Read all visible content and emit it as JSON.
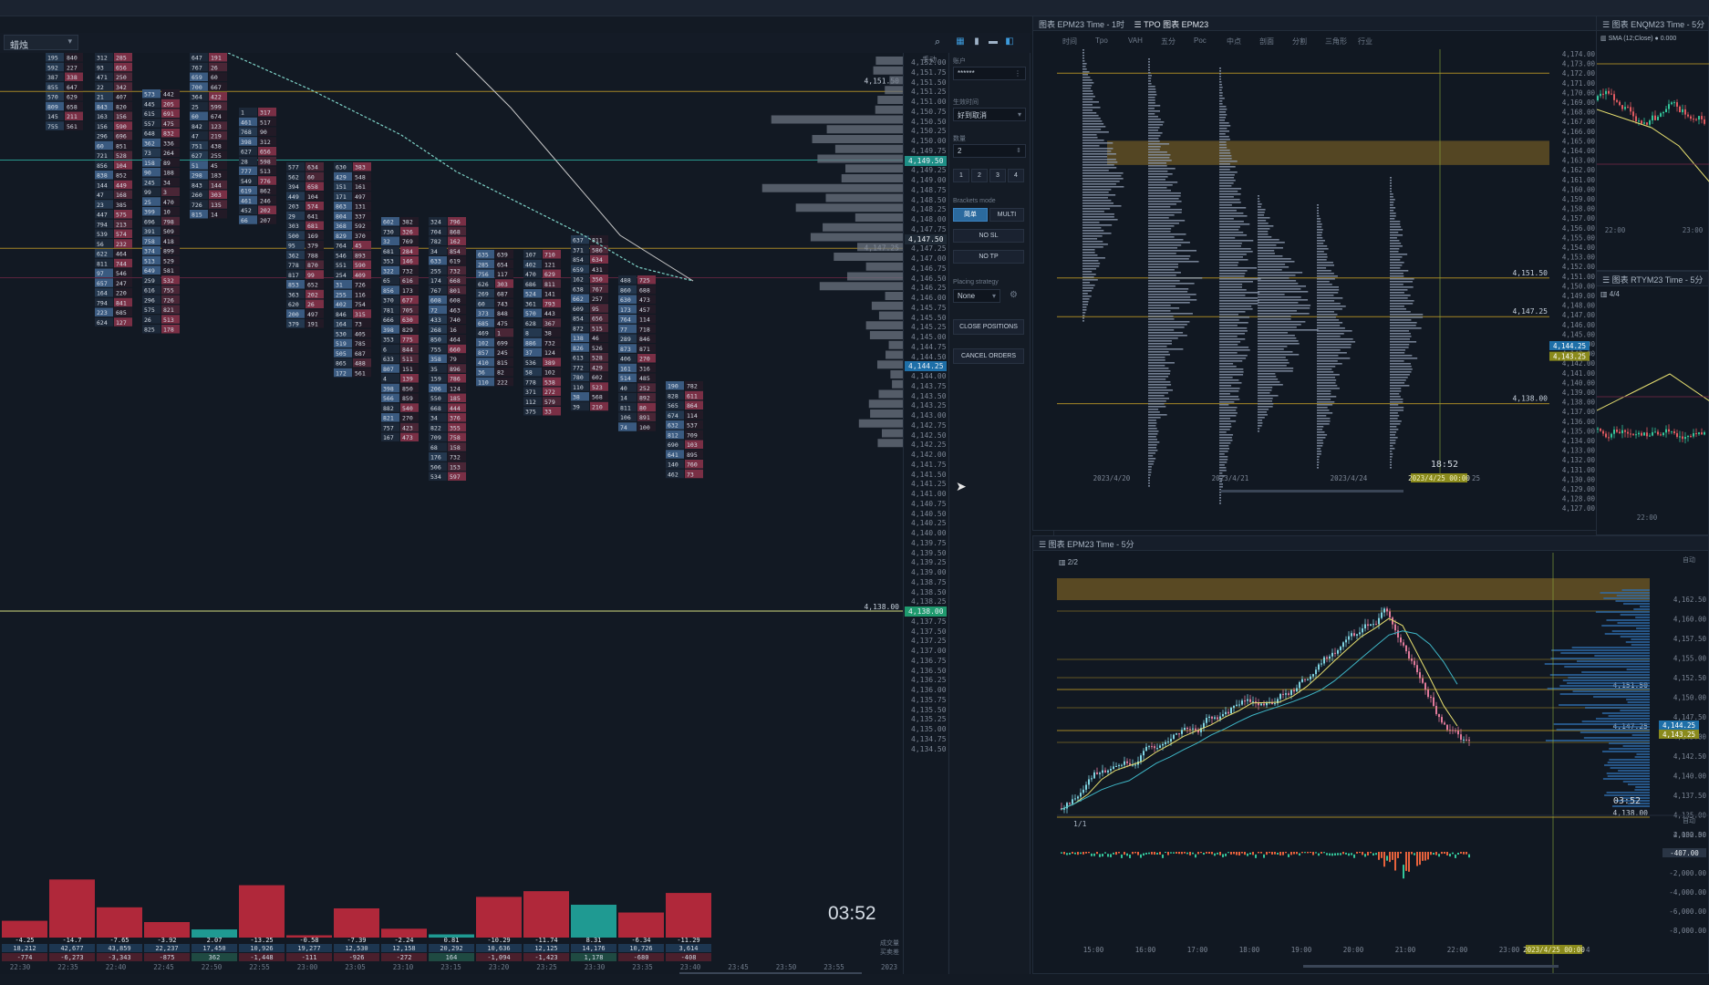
{
  "topbar": {},
  "main": {
    "instrument": "蜡烛",
    "price_ticks": [
      "4,152.00",
      "4,151.75",
      "4,151.50",
      "4,151.25",
      "4,151.00",
      "4,150.75",
      "4,150.50",
      "4,150.25",
      "4,150.00",
      "4,149.75",
      "4,149.50",
      "4,149.25",
      "4,149.00",
      "4,148.75",
      "4,148.50",
      "4,148.25",
      "4,148.00",
      "4,147.75",
      "4,147.50",
      "4,147.25",
      "4,147.00",
      "4,146.75",
      "4,146.50",
      "4,146.25",
      "4,146.00",
      "4,145.75",
      "4,145.50",
      "4,145.25",
      "4,145.00",
      "4,144.75",
      "4,144.50",
      "4,144.25",
      "4,144.00",
      "4,143.75",
      "4,143.50",
      "4,143.25",
      "4,143.00",
      "4,142.75",
      "4,142.50",
      "4,142.25",
      "4,142.00",
      "4,141.75",
      "4,141.50",
      "4,141.25",
      "4,141.00",
      "4,140.75",
      "4,140.50",
      "4,140.25",
      "4,140.00",
      "4,139.75",
      "4,139.50",
      "4,139.25",
      "4,139.00",
      "4,138.75",
      "4,138.50",
      "4,138.25",
      "4,138.00",
      "4,137.75",
      "4,137.50",
      "4,137.25",
      "4,137.00",
      "4,136.75",
      "4,136.50",
      "4,136.25",
      "4,136.00",
      "4,135.75",
      "4,135.50",
      "4,135.25",
      "4,135.00",
      "4,134.75",
      "4,134.50"
    ],
    "price_hl": [
      {
        "label": "4,149.50",
        "color": "#1e8f86"
      },
      {
        "label": "4,147.50",
        "color": "#1f2a36"
      },
      {
        "label": "4,144.25",
        "color": "#1e6fa8"
      },
      {
        "label": "4,138.00",
        "color": "#1f9a6e"
      }
    ],
    "level_labels": [
      "4,151.50",
      "4,147.25",
      "4,138.00"
    ],
    "axis_corner": "手动",
    "delta_labels": [
      "-4.25",
      "-14.7",
      "-7.65",
      "-3.92",
      "2.07",
      "-13.25",
      "-0.58",
      "-7.39",
      "-2.24",
      "0.81",
      "-10.29",
      "-11.74",
      "8.31",
      "-6.34",
      "-11.29"
    ],
    "delta_vol": [
      "18,212",
      "42,677",
      "43,859",
      "22,237",
      "17,450",
      "10,926",
      "19,277",
      "12,530",
      "12,158",
      "20,292",
      "10,636",
      "12,125",
      "14,176",
      "10,726",
      "3,614"
    ],
    "delta_sum": [
      "-774",
      "-6,273",
      "-3,343",
      "-875",
      "362",
      "-1,448",
      "-111",
      "-926",
      "-272",
      "164",
      "-1,094",
      "-1,423",
      "1,178",
      "-680",
      "-408"
    ],
    "delta_values": [
      -4.25,
      -14.7,
      -7.65,
      -3.92,
      2.07,
      -13.25,
      -0.58,
      -7.39,
      -2.24,
      0.81,
      -10.29,
      -11.74,
      8.31,
      -6.34,
      -11.29
    ],
    "time_ticks": [
      "22:30",
      "22:35",
      "22:40",
      "22:45",
      "22:50",
      "22:55",
      "23:00",
      "23:05",
      "23:10",
      "23:15",
      "23:20",
      "23:25",
      "23:30",
      "23:35",
      "23:40",
      "23:45",
      "23:50",
      "23:55"
    ],
    "time_year": "2023",
    "clock": "03:52",
    "bottom_labels": [
      "成交量",
      "买卖差"
    ]
  },
  "order_panel": {
    "account_label": "账户",
    "account_value": "******",
    "tif_label": "生效时间",
    "tif_value": "好到取消",
    "qty_label": "数量",
    "qty_value": "2",
    "qty_presets": [
      "1",
      "2",
      "3",
      "4"
    ],
    "brackets_label": "Brackets mode",
    "mode_single": "简单",
    "mode_multi": "MULTI",
    "no_sl": "NO SL",
    "no_tp": "NO TP",
    "placing_label": "Placing strategy",
    "placing_value": "None",
    "close_positions": "CLOSE POSITIONS",
    "cancel_orders": "CANCEL ORDERS"
  },
  "tpo_pane": {
    "tab1": "图表 EPM23 Time - 1时",
    "tab2": "TPO 图表 EPM23",
    "toolbar_items": [
      "时间",
      "Tpo",
      "VAH",
      "五分",
      "Poc",
      "中点",
      "剖面",
      "分割",
      "三角形",
      "行业"
    ],
    "prices": [
      "4,174.00",
      "4,173.00",
      "4,172.00",
      "4,171.00",
      "4,170.00",
      "4,169.00",
      "4,168.00",
      "4,167.00",
      "4,166.00",
      "4,165.00",
      "4,164.00",
      "4,163.00",
      "4,162.00",
      "4,161.00",
      "4,160.00",
      "4,159.00",
      "4,158.00",
      "4,157.00",
      "4,156.00",
      "4,155.00",
      "4,154.00",
      "4,153.00",
      "4,152.00",
      "4,151.00",
      "4,150.00",
      "4,149.00",
      "4,148.00",
      "4,147.00",
      "4,146.00",
      "4,145.00",
      "4,144.00",
      "4,143.00",
      "4,142.00",
      "4,141.00",
      "4,140.00",
      "4,139.00",
      "4,138.00",
      "4,137.00",
      "4,136.00",
      "4,135.00",
      "4,134.00",
      "4,133.00",
      "4,132.00",
      "4,131.00",
      "4,130.00",
      "4,129.00",
      "4,128.00",
      "4,127.00"
    ],
    "levels": [
      "4,151.50",
      "4,147.25",
      "4,138.00"
    ],
    "price_hl": [
      "4,144.25",
      "4,143.25"
    ],
    "dates": [
      "2023/4/20",
      "2023/4/21",
      "2023/4/24"
    ],
    "date_hl": "2023/4/25 00:00",
    "date_tail": "25",
    "clock": "18:52"
  },
  "nq_pane": {
    "tab": "图表 ENQM23 Time - 5分",
    "indicator": "SMA (12;Close)",
    "indicator_val": "0.000",
    "times": [
      "22:00",
      "23:00"
    ]
  },
  "rty_pane": {
    "tab": "图表 RTYM23 Time - 5分",
    "page": "4/4",
    "times": [
      "22:00"
    ]
  },
  "es5_pane": {
    "tab": "图表 EPM23 Time - 5分",
    "page": "2/2",
    "prices": [
      "4,162.50",
      "4,160.00",
      "4,157.50",
      "4,155.00",
      "4,152.50",
      "4,150.00",
      "4,147.50",
      "4,145.00",
      "4,142.50",
      "4,140.00",
      "4,137.50",
      "4,135.00",
      "4,132.50"
    ],
    "levels": [
      "4,151.50",
      "4,147.25",
      "4,138.00"
    ],
    "price_hl": [
      "4,144.25",
      "4,143.25"
    ],
    "clock": "03:52",
    "corner": "自动"
  },
  "osc_pane": {
    "page": "1/1",
    "prices": [
      "2,000.00",
      "0.00",
      "-2,000.00",
      "-4,000.00",
      "-6,000.00",
      "-8,000.00"
    ],
    "price_hl": "-407.00",
    "corner": "自动",
    "times": [
      "15:00",
      "16:00",
      "17:00",
      "18:00",
      "19:00",
      "20:00",
      "21:00",
      "22:00",
      "23:00",
      "2:00"
    ],
    "date_hl": "2023/4/25 00:00",
    "date_tail": "4"
  },
  "colors": {
    "bg": "#121923",
    "bid": "#2a4a6e",
    "ask": "#6b2a3c",
    "delta_neg": "#b0283a",
    "delta_pos": "#1f9a92",
    "level": "#c9a227",
    "ma_fast": "#7fd3c8",
    "ma_slow": "#c8c8c8",
    "teal_line": "#2fb8a8"
  }
}
